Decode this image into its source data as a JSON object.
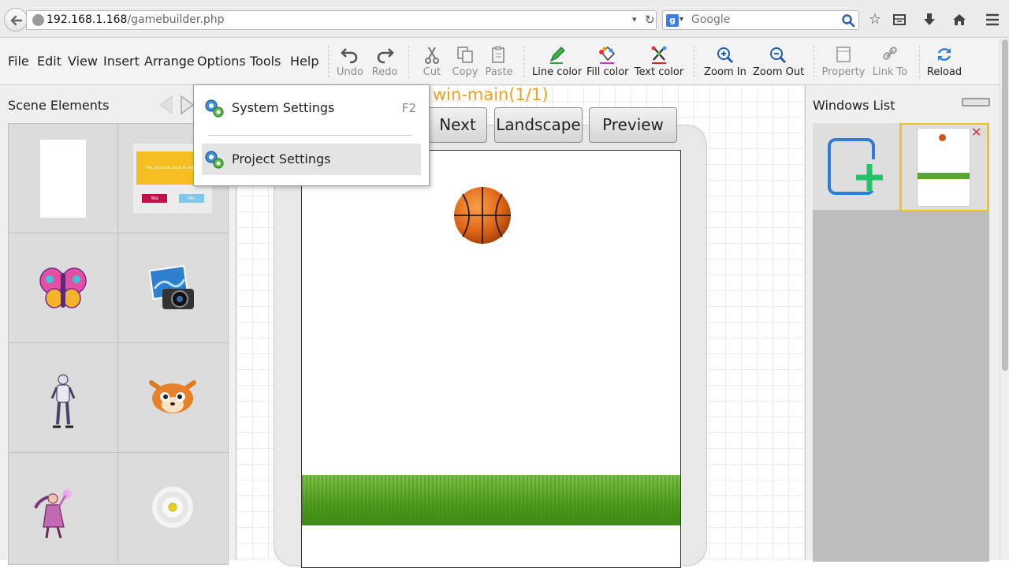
{
  "browser": {
    "url_host": "192.168.1.168",
    "url_path": "/gamebuilder.php",
    "search_placeholder": "Google",
    "search_engine_letter": "g"
  },
  "menubar": [
    "File",
    "Edit",
    "View",
    "Insert",
    "Arrange",
    "Options",
    "Tools",
    "Help"
  ],
  "toolbar": {
    "undo": "Undo",
    "redo": "Redo",
    "cut": "Cut",
    "copy": "Copy",
    "paste": "Paste",
    "line_color": "Line color",
    "fill_color": "Fill color",
    "text_color": "Text color",
    "zoom_in": "Zoom In",
    "zoom_out": "Zoom Out",
    "property": "Property",
    "link_to": "Link To",
    "reload": "Reload"
  },
  "scene_panel": {
    "title": "Scene Elements",
    "dialog_text": "Are you sure back to main?",
    "dialog_yes": "Yes",
    "dialog_no": "No"
  },
  "canvas": {
    "window_title": "win-main(1/1)",
    "buttons": [
      "Next",
      "Landscape",
      "Preview"
    ]
  },
  "windows_panel": {
    "title": "Windows List"
  },
  "options_menu": {
    "items": [
      {
        "label": "System Settings",
        "shortcut": "F2"
      },
      {
        "label": "Project Settings",
        "shortcut": ""
      }
    ]
  },
  "colors": {
    "accent_title": "#f0a020",
    "selected_border": "#f0c419",
    "add_plus": "#22c46a",
    "add_frame": "#2b7fd4"
  }
}
